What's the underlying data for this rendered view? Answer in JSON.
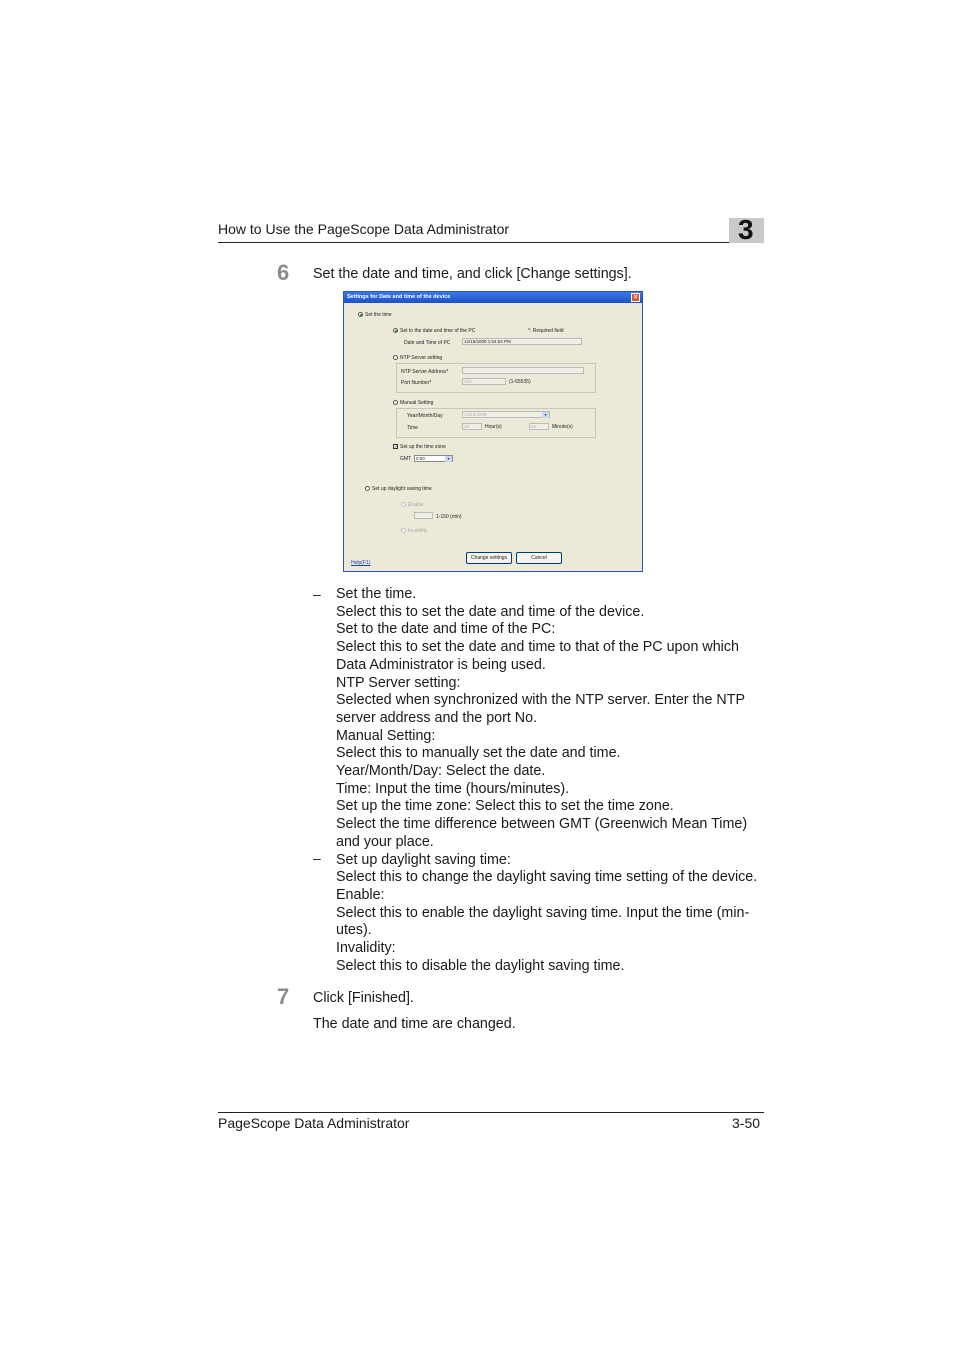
{
  "header": {
    "title": "How to Use the PageScope Data Administrator",
    "chapter": "3"
  },
  "steps": [
    {
      "number": "6",
      "text": "Set the date and time, and click [Change settings]."
    },
    {
      "number": "7",
      "text": "Click [Finished].",
      "result": "The date and time are changed."
    }
  ],
  "dialog": {
    "title": "Settings for Date and time of the device",
    "close_glyph": "×",
    "set_time_label": "Set the time",
    "pc_radio_label": "Set to the date and time of the PC",
    "required_note": "*: Required field",
    "pc_datetime_label": "Date and Time of PC",
    "pc_datetime_value": "12/15/2009 1:54:54 PM",
    "ntp_radio_label": "NTP Server setting",
    "ntp_address_label": "NTP Server Address*",
    "ntp_port_label": "Port Number*",
    "ntp_port_value": "123",
    "ntp_port_range": "(1-65535)",
    "manual_radio_label": "Manual Setting",
    "ymd_label": "Year/Month/Day",
    "ymd_value": "12/15/2009",
    "time_label": "Time",
    "hour_value": "13",
    "hour_unit": "Hour(s)",
    "minute_value": "54",
    "minute_unit": "Minute(s)",
    "timezone_check_label": "Set up the time zone",
    "gmt_label": "GMT",
    "gmt_value": "0:00",
    "dst_radio_label": "Set up daylight saving time",
    "enable_label": "Enable",
    "dst_range": "1-150 (min)",
    "invalidity_label": "Invalidity",
    "help_link": "Help(F1)",
    "change_button": "Change settings",
    "cancel_button": "Cancel"
  },
  "explanations": [
    {
      "dash": "–",
      "text": "Set the time."
    },
    {
      "text": "Select this to set the date and time of the device."
    },
    {
      "text": "Set to the date and time of the PC:"
    },
    {
      "text": "Select this to set the date and time to that of the PC upon which"
    },
    {
      "text": "Data Administrator is being used."
    },
    {
      "text": "NTP Server setting:"
    },
    {
      "text": "Selected when synchronized with the NTP server. Enter the NTP"
    },
    {
      "text": "server address and the port No."
    },
    {
      "text": "Manual Setting:"
    },
    {
      "text": "Select this to manually set the date and time."
    },
    {
      "text": "Year/Month/Day: Select the date."
    },
    {
      "text": "Time: Input the time (hours/minutes)."
    },
    {
      "text": "Set up the time zone: Select this to set the time zone."
    },
    {
      "text": "Select the time difference between GMT (Greenwich Mean Time)"
    },
    {
      "text": "and your place."
    },
    {
      "dash": "–",
      "text": "Set up daylight saving time:"
    },
    {
      "text": "Select this to change the daylight saving time setting of the device."
    },
    {
      "text": "Enable:"
    },
    {
      "text": "Select this to enable the daylight saving time. Input the time (min-"
    },
    {
      "text": "utes)."
    },
    {
      "text": "Invalidity:"
    },
    {
      "text": "Select this to disable the daylight saving time."
    }
  ],
  "footer": {
    "left": "PageScope Data Administrator",
    "right": "3-50"
  }
}
